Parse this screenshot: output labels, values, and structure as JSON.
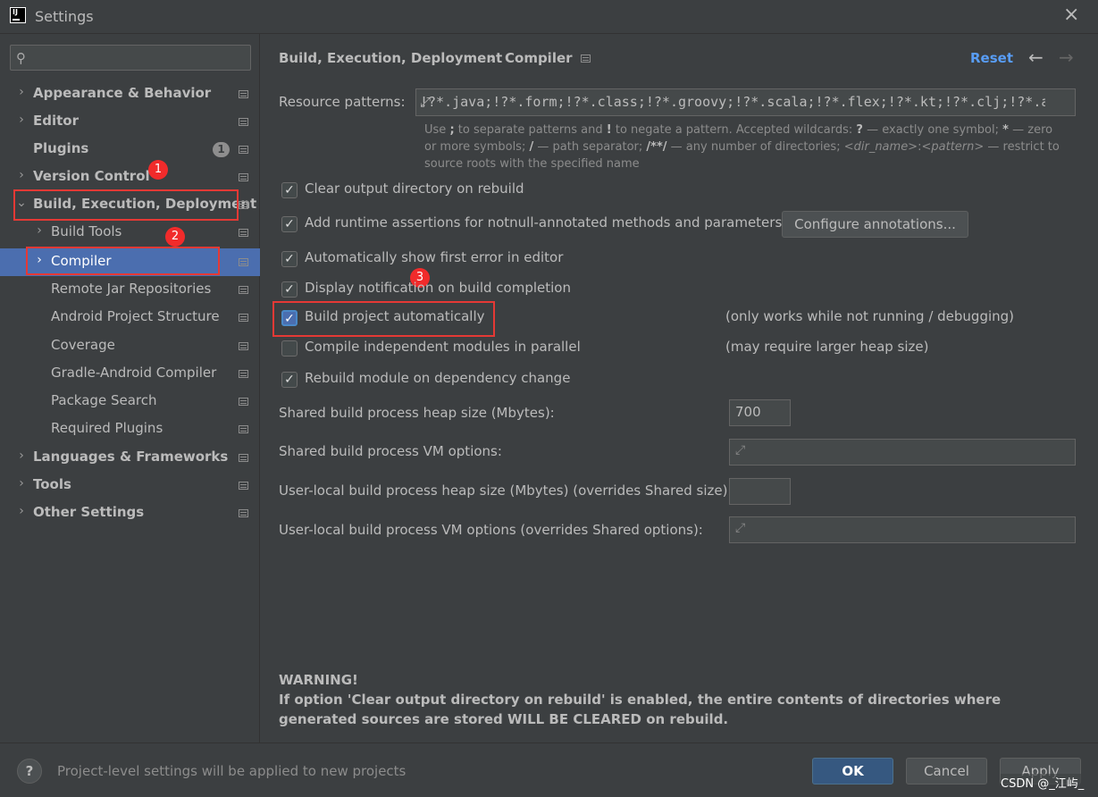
{
  "window": {
    "title": "Settings",
    "logo_text": "IJ"
  },
  "search": {
    "placeholder": ""
  },
  "sidebar": {
    "items": [
      {
        "label": "Appearance & Behavior"
      },
      {
        "label": "Editor"
      },
      {
        "label": "Plugins",
        "badge": "1"
      },
      {
        "label": "Version Control"
      },
      {
        "label": "Build, Execution, Deployment"
      },
      {
        "label": "Build Tools"
      },
      {
        "label": "Compiler"
      },
      {
        "label": "Remote Jar Repositories"
      },
      {
        "label": "Android Project Structure"
      },
      {
        "label": "Coverage"
      },
      {
        "label": "Gradle-Android Compiler"
      },
      {
        "label": "Package Search"
      },
      {
        "label": "Required Plugins"
      },
      {
        "label": "Languages & Frameworks"
      },
      {
        "label": "Tools"
      },
      {
        "label": "Other Settings"
      }
    ]
  },
  "annotations": {
    "one": "1",
    "two": "2",
    "three": "3"
  },
  "header": {
    "breadcrumb_parent": "Build, Execution, Deployment",
    "breadcrumb_sep": "›",
    "breadcrumb_current": "Compiler",
    "reset_label": "Reset",
    "back_icon": "←",
    "forward_icon": "→"
  },
  "resource_patterns": {
    "label": "Resource patterns:",
    "value": "!?*.java;!?*.form;!?*.class;!?*.groovy;!?*.scala;!?*.flex;!?*.kt;!?*.clj;!?*.aj",
    "hint_1": "Use",
    "hint_semicolon": ";",
    "hint_2": "to separate patterns and",
    "hint_bang": "!",
    "hint_3": "to negate a pattern. Accepted wildcards:",
    "hint_q": "?",
    "hint_4": "— exactly one symbol;",
    "hint_star": "*",
    "hint_5": "— zero or more symbols;",
    "hint_slash": "/",
    "hint_6": "— path separator;",
    "hint_dstar": "/**/",
    "hint_7": "— any number of directories;",
    "hint_dir": "<dir_name>",
    "hint_colon": ":",
    "hint_pattern": "<pattern>",
    "hint_8": "— restrict to source roots with the specified name"
  },
  "options": {
    "clear_output": {
      "label": "Clear output directory on rebuild",
      "checked": true
    },
    "runtime_assertions": {
      "label": "Add runtime assertions for notnull-annotated methods and parameters",
      "checked": true
    },
    "configure_annotations": "Configure annotations...",
    "show_first_error": {
      "label": "Automatically show first error in editor",
      "checked": true
    },
    "display_notification": {
      "label": "Display notification on build completion",
      "checked": true
    },
    "build_automatically": {
      "label": "Build project automatically",
      "checked": true,
      "note": "(only works while not running / debugging)"
    },
    "compile_parallel": {
      "label": "Compile independent modules in parallel",
      "checked": false,
      "note": "(may require larger heap size)"
    },
    "rebuild_on_dependency": {
      "label": "Rebuild module on dependency change",
      "checked": true
    }
  },
  "fields": {
    "shared_heap": {
      "label": "Shared build process heap size (Mbytes):",
      "value": "700"
    },
    "shared_vm": {
      "label": "Shared build process VM options:",
      "value": ""
    },
    "user_heap": {
      "label": "User-local build process heap size (Mbytes) (overrides Shared size):",
      "value": ""
    },
    "user_vm": {
      "label": "User-local build process VM options (overrides Shared options):",
      "value": ""
    }
  },
  "warning": {
    "title": "WARNING!",
    "body": "If option 'Clear output directory on rebuild' is enabled, the entire contents of directories where generated sources are stored WILL BE CLEARED on rebuild."
  },
  "footer": {
    "help_label": "?",
    "info_text": "Project-level settings will be applied to new projects",
    "ok_label": "OK",
    "cancel_label": "Cancel",
    "apply_label": "Apply",
    "watermark": "CSDN @_江屿_"
  },
  "icons": {
    "search": "search-icon",
    "close": "close-icon",
    "chevron": "chevron-right-icon",
    "check": "check-icon",
    "expand": "expand-icon",
    "doc": "project-scope-icon"
  },
  "colors": {
    "accent": "#4b6eaf",
    "link": "#589df6",
    "annotation_red": "#e53935"
  }
}
